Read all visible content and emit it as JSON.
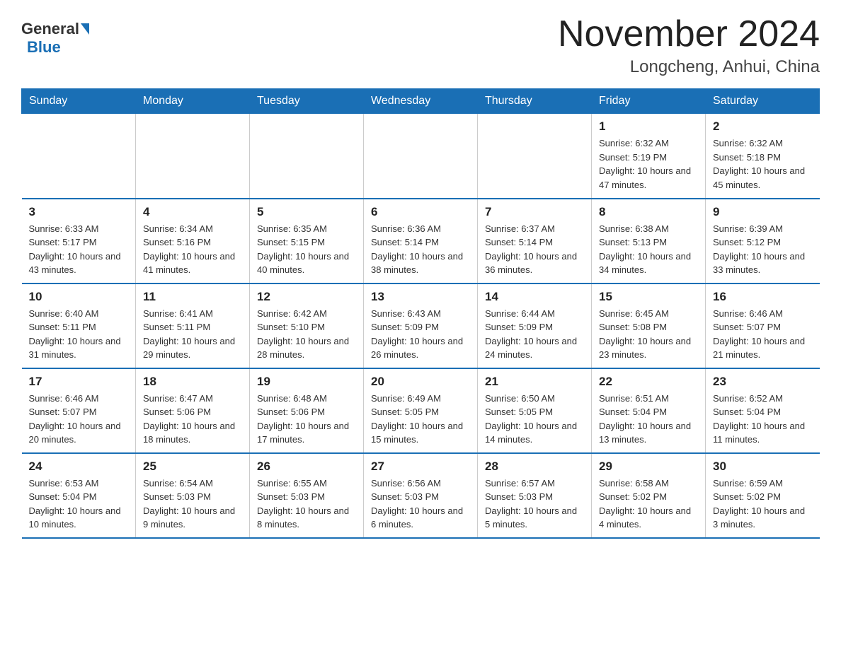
{
  "header": {
    "logo_general": "General",
    "logo_blue": "Blue",
    "month_title": "November 2024",
    "location": "Longcheng, Anhui, China"
  },
  "weekdays": [
    "Sunday",
    "Monday",
    "Tuesday",
    "Wednesday",
    "Thursday",
    "Friday",
    "Saturday"
  ],
  "weeks": [
    [
      {
        "day": "",
        "info": ""
      },
      {
        "day": "",
        "info": ""
      },
      {
        "day": "",
        "info": ""
      },
      {
        "day": "",
        "info": ""
      },
      {
        "day": "",
        "info": ""
      },
      {
        "day": "1",
        "info": "Sunrise: 6:32 AM\nSunset: 5:19 PM\nDaylight: 10 hours and 47 minutes."
      },
      {
        "day": "2",
        "info": "Sunrise: 6:32 AM\nSunset: 5:18 PM\nDaylight: 10 hours and 45 minutes."
      }
    ],
    [
      {
        "day": "3",
        "info": "Sunrise: 6:33 AM\nSunset: 5:17 PM\nDaylight: 10 hours and 43 minutes."
      },
      {
        "day": "4",
        "info": "Sunrise: 6:34 AM\nSunset: 5:16 PM\nDaylight: 10 hours and 41 minutes."
      },
      {
        "day": "5",
        "info": "Sunrise: 6:35 AM\nSunset: 5:15 PM\nDaylight: 10 hours and 40 minutes."
      },
      {
        "day": "6",
        "info": "Sunrise: 6:36 AM\nSunset: 5:14 PM\nDaylight: 10 hours and 38 minutes."
      },
      {
        "day": "7",
        "info": "Sunrise: 6:37 AM\nSunset: 5:14 PM\nDaylight: 10 hours and 36 minutes."
      },
      {
        "day": "8",
        "info": "Sunrise: 6:38 AM\nSunset: 5:13 PM\nDaylight: 10 hours and 34 minutes."
      },
      {
        "day": "9",
        "info": "Sunrise: 6:39 AM\nSunset: 5:12 PM\nDaylight: 10 hours and 33 minutes."
      }
    ],
    [
      {
        "day": "10",
        "info": "Sunrise: 6:40 AM\nSunset: 5:11 PM\nDaylight: 10 hours and 31 minutes."
      },
      {
        "day": "11",
        "info": "Sunrise: 6:41 AM\nSunset: 5:11 PM\nDaylight: 10 hours and 29 minutes."
      },
      {
        "day": "12",
        "info": "Sunrise: 6:42 AM\nSunset: 5:10 PM\nDaylight: 10 hours and 28 minutes."
      },
      {
        "day": "13",
        "info": "Sunrise: 6:43 AM\nSunset: 5:09 PM\nDaylight: 10 hours and 26 minutes."
      },
      {
        "day": "14",
        "info": "Sunrise: 6:44 AM\nSunset: 5:09 PM\nDaylight: 10 hours and 24 minutes."
      },
      {
        "day": "15",
        "info": "Sunrise: 6:45 AM\nSunset: 5:08 PM\nDaylight: 10 hours and 23 minutes."
      },
      {
        "day": "16",
        "info": "Sunrise: 6:46 AM\nSunset: 5:07 PM\nDaylight: 10 hours and 21 minutes."
      }
    ],
    [
      {
        "day": "17",
        "info": "Sunrise: 6:46 AM\nSunset: 5:07 PM\nDaylight: 10 hours and 20 minutes."
      },
      {
        "day": "18",
        "info": "Sunrise: 6:47 AM\nSunset: 5:06 PM\nDaylight: 10 hours and 18 minutes."
      },
      {
        "day": "19",
        "info": "Sunrise: 6:48 AM\nSunset: 5:06 PM\nDaylight: 10 hours and 17 minutes."
      },
      {
        "day": "20",
        "info": "Sunrise: 6:49 AM\nSunset: 5:05 PM\nDaylight: 10 hours and 15 minutes."
      },
      {
        "day": "21",
        "info": "Sunrise: 6:50 AM\nSunset: 5:05 PM\nDaylight: 10 hours and 14 minutes."
      },
      {
        "day": "22",
        "info": "Sunrise: 6:51 AM\nSunset: 5:04 PM\nDaylight: 10 hours and 13 minutes."
      },
      {
        "day": "23",
        "info": "Sunrise: 6:52 AM\nSunset: 5:04 PM\nDaylight: 10 hours and 11 minutes."
      }
    ],
    [
      {
        "day": "24",
        "info": "Sunrise: 6:53 AM\nSunset: 5:04 PM\nDaylight: 10 hours and 10 minutes."
      },
      {
        "day": "25",
        "info": "Sunrise: 6:54 AM\nSunset: 5:03 PM\nDaylight: 10 hours and 9 minutes."
      },
      {
        "day": "26",
        "info": "Sunrise: 6:55 AM\nSunset: 5:03 PM\nDaylight: 10 hours and 8 minutes."
      },
      {
        "day": "27",
        "info": "Sunrise: 6:56 AM\nSunset: 5:03 PM\nDaylight: 10 hours and 6 minutes."
      },
      {
        "day": "28",
        "info": "Sunrise: 6:57 AM\nSunset: 5:03 PM\nDaylight: 10 hours and 5 minutes."
      },
      {
        "day": "29",
        "info": "Sunrise: 6:58 AM\nSunset: 5:02 PM\nDaylight: 10 hours and 4 minutes."
      },
      {
        "day": "30",
        "info": "Sunrise: 6:59 AM\nSunset: 5:02 PM\nDaylight: 10 hours and 3 minutes."
      }
    ]
  ]
}
